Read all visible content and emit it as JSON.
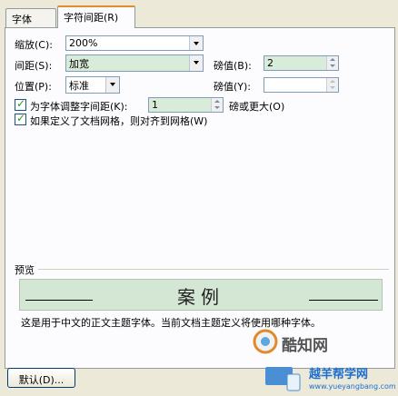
{
  "tabs": {
    "font": "字体",
    "spacing": "字符间距(R)"
  },
  "scale": {
    "label": "缩放(C):",
    "value": "200%"
  },
  "spacing": {
    "label": "间距(S):",
    "value": "加宽",
    "by_label": "磅值(B):",
    "by_value": "2"
  },
  "position": {
    "label": "位置(P):",
    "value": "标准",
    "by_label": "磅值(Y):",
    "by_value": ""
  },
  "kerning": {
    "label": "为字体调整字间距(K):",
    "value": "1",
    "suffix": "磅或更大(O)",
    "checked": true
  },
  "snap_grid": {
    "label": "如果定义了文档网格，则对齐到网格(W)",
    "checked": true
  },
  "preview": {
    "heading": "预览",
    "sample": "案例",
    "note": "这是用于中文的正文主题字体。当前文档主题定义将使用哪种字体。"
  },
  "footer": {
    "default_button": "默认(D)..."
  },
  "watermark": {
    "brand_cn": "酷知网",
    "site_cn": "越羊帮学网",
    "site_url": "www.yueyangbang.com"
  },
  "colors": {
    "accent_tab": "#e68b2c",
    "field_green": "#d9ecd9",
    "preview_bg": "#d4e7d4",
    "dialog_bg": "#ece9d8"
  }
}
